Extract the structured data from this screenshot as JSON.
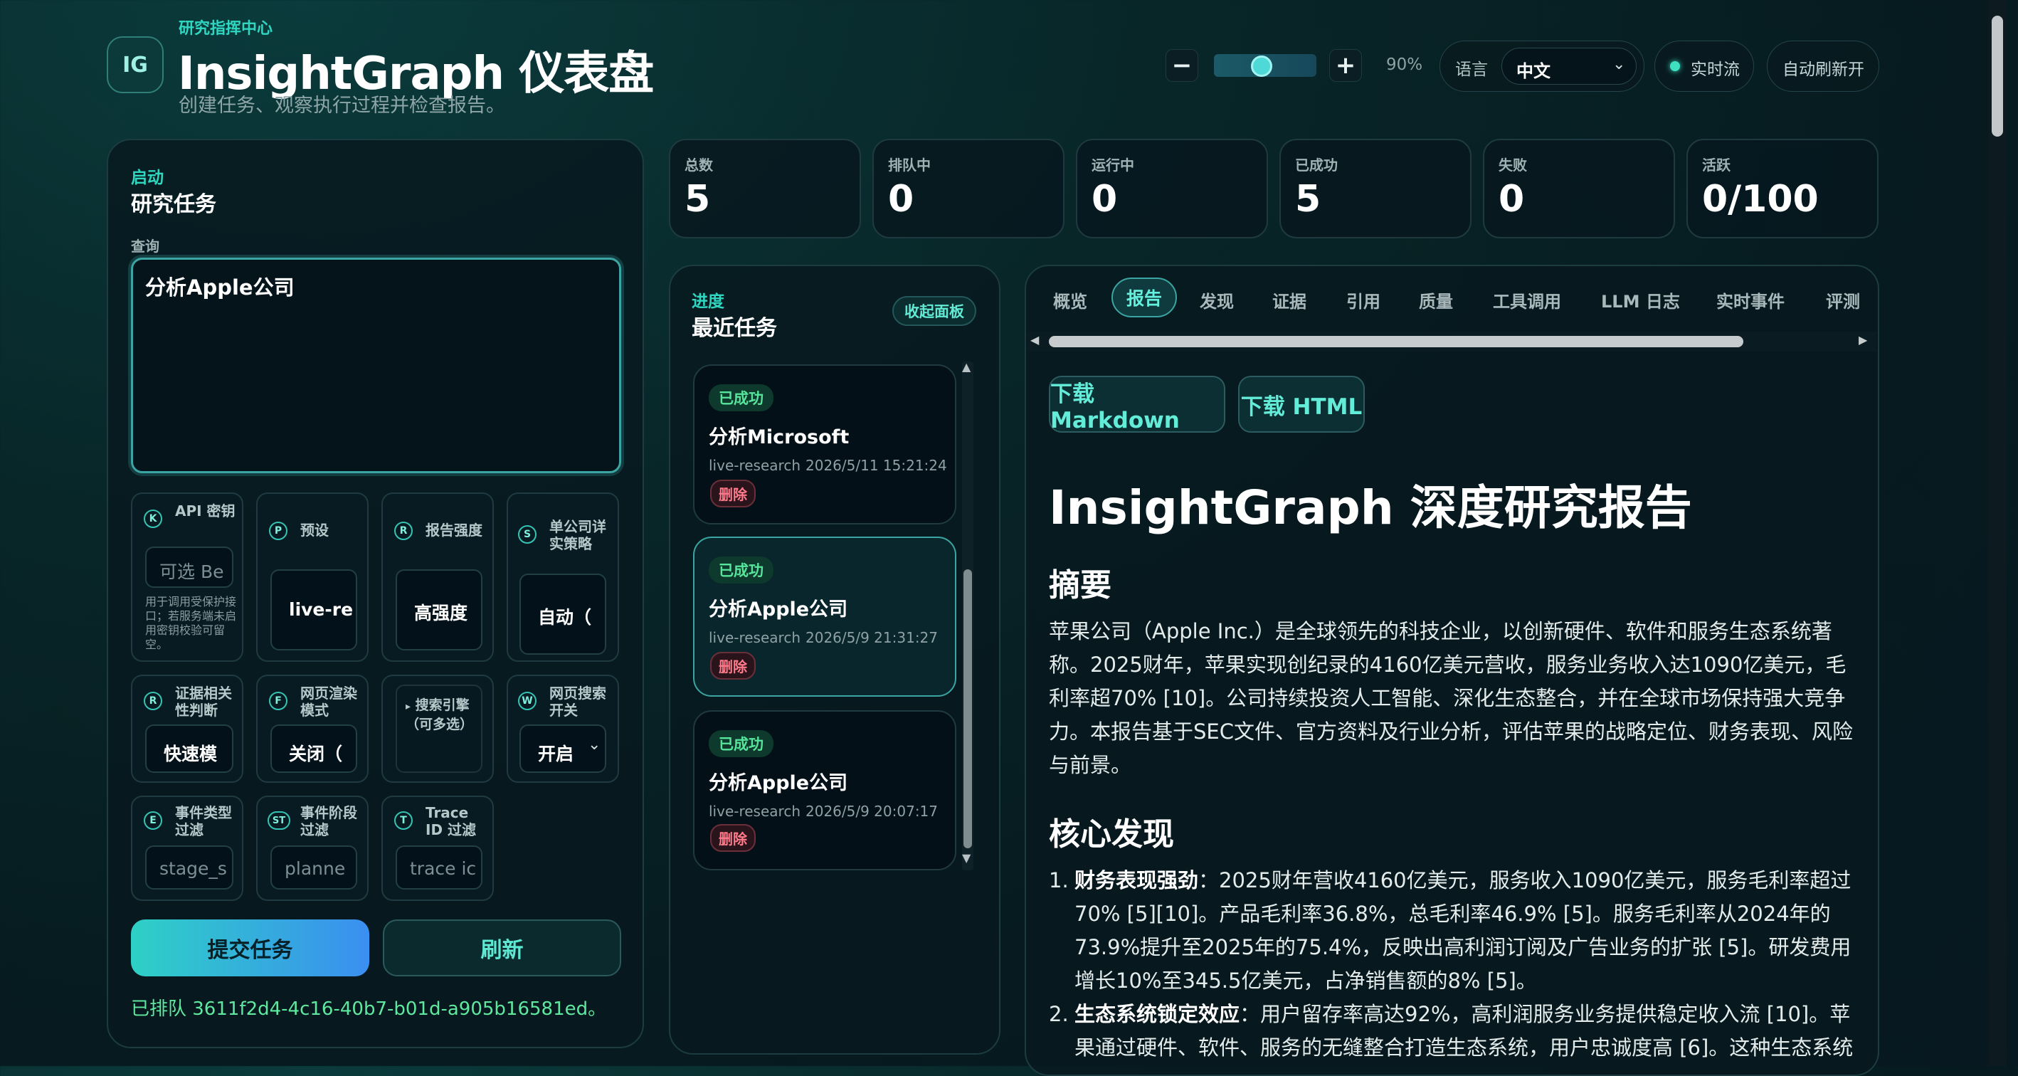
{
  "header": {
    "logo": "IG",
    "eyebrow": "研究指挥中心",
    "title": "InsightGraph 仪表盘",
    "subtitle": "创建任务、观察执行过程并检查报告。"
  },
  "zoom": {
    "minus": "−",
    "plus": "+",
    "value_label": "90%",
    "level": 0.9
  },
  "language": {
    "label": "语言",
    "selected": "中文"
  },
  "live": {
    "label": "实时流"
  },
  "auto_refresh": {
    "label": "自动刷新开"
  },
  "launch": {
    "eyebrow": "启动",
    "title": "研究任务",
    "query_label": "查询",
    "query_value": "分析Apple公司"
  },
  "options": {
    "api_key": {
      "badge": "K",
      "label": "API 密钥",
      "placeholder": "可选 Be",
      "help": "用于调用受保护接口；若服务端未启用密钥校验可留空。"
    },
    "preset": {
      "badge": "P",
      "label": "预设",
      "value": "live-re"
    },
    "report_strength": {
      "badge": "R",
      "label": "报告强度",
      "value": "高强度"
    },
    "single_company": {
      "badge": "S",
      "label": "单公司详实策略",
      "value": "自动（"
    },
    "evidence": {
      "badge": "R",
      "label": "证据相关性判断",
      "value": "快速模"
    },
    "web_render": {
      "badge": "F",
      "label": "网页渲染模式",
      "value": "关闭（"
    },
    "search_engine": {
      "label": "搜索引擎（可多选）"
    },
    "web_search": {
      "badge": "W",
      "label": "网页搜索开关",
      "value": "开启"
    },
    "event_type": {
      "badge": "E",
      "label": "事件类型过滤",
      "placeholder": "stage_s"
    },
    "event_stage": {
      "badge": "ST",
      "label": "事件阶段过滤",
      "placeholder": "planne"
    },
    "trace": {
      "badge": "T",
      "label": "Trace ID 过滤",
      "placeholder": "trace ic"
    }
  },
  "actions": {
    "submit": "提交任务",
    "refresh": "刷新"
  },
  "status_message": "已排队 3611f2d4-4c16-40b7-b01d-a905b16581ed。",
  "stats": [
    {
      "label": "总数",
      "value": "5"
    },
    {
      "label": "排队中",
      "value": "0"
    },
    {
      "label": "运行中",
      "value": "0"
    },
    {
      "label": "已成功",
      "value": "5"
    },
    {
      "label": "失败",
      "value": "0"
    },
    {
      "label": "活跃",
      "value": "0/100"
    }
  ],
  "progress": {
    "eyebrow": "进度",
    "title": "最近任务",
    "collapse": "收起面板",
    "tasks": [
      {
        "status": "已成功",
        "title": "分析Microsoft",
        "preset": "live-research",
        "time": "2026/5/11 15:21:24",
        "delete": "删除"
      },
      {
        "status": "已成功",
        "title": "分析Apple公司",
        "preset": "live-research",
        "time": "2026/5/9 21:31:27",
        "delete": "删除"
      },
      {
        "status": "已成功",
        "title": "分析Apple公司",
        "preset": "live-research",
        "time": "2026/5/9 20:07:17",
        "delete": "删除"
      }
    ]
  },
  "tabs": [
    "概览",
    "报告",
    "发现",
    "证据",
    "引用",
    "质量",
    "工具调用",
    "LLM 日志",
    "实时事件",
    "评测"
  ],
  "active_tab": "报告",
  "downloads": {
    "markdown": "下载 Markdown",
    "html": "下载 HTML"
  },
  "report": {
    "title": "InsightGraph 深度研究报告",
    "summary_heading": "摘要",
    "summary": "苹果公司（Apple Inc.）是全球领先的科技企业，以创新硬件、软件和服务生态系统著称。2025财年，苹果实现创纪录的4160亿美元营收，服务业务收入达1090亿美元，毛利率超70% [10]。公司持续投资人工智能、深化生态整合，并在全球市场保持强大竞争力。本报告基于SEC文件、官方资料及行业分析，评估苹果的战略定位、财务表现、风险与前景。",
    "findings_heading": "核心发现",
    "findings": [
      {
        "num": "1.",
        "bold": "财务表现强劲",
        "text": "：2025财年营收4160亿美元，服务收入1090亿美元，服务毛利率超过70% [5][10]。产品毛利率36.8%，总毛利率46.9% [5]。服务毛利率从2024年的73.9%提升至2025年的75.4%，反映出高利润订阅及广告业务的扩张 [5]。研发费用增长10%至345.5亿美元，占净销售额的8% [5]。"
      },
      {
        "num": "2.",
        "bold": "生态系统锁定效应",
        "text": "：用户留存率高达92%，高利润服务业务提供稳定收入流 [10]。苹果通过硬件、软件、服务的无缝整合打造生态系统，用户忠诚度高 [6]。这种生态系统"
      }
    ]
  }
}
